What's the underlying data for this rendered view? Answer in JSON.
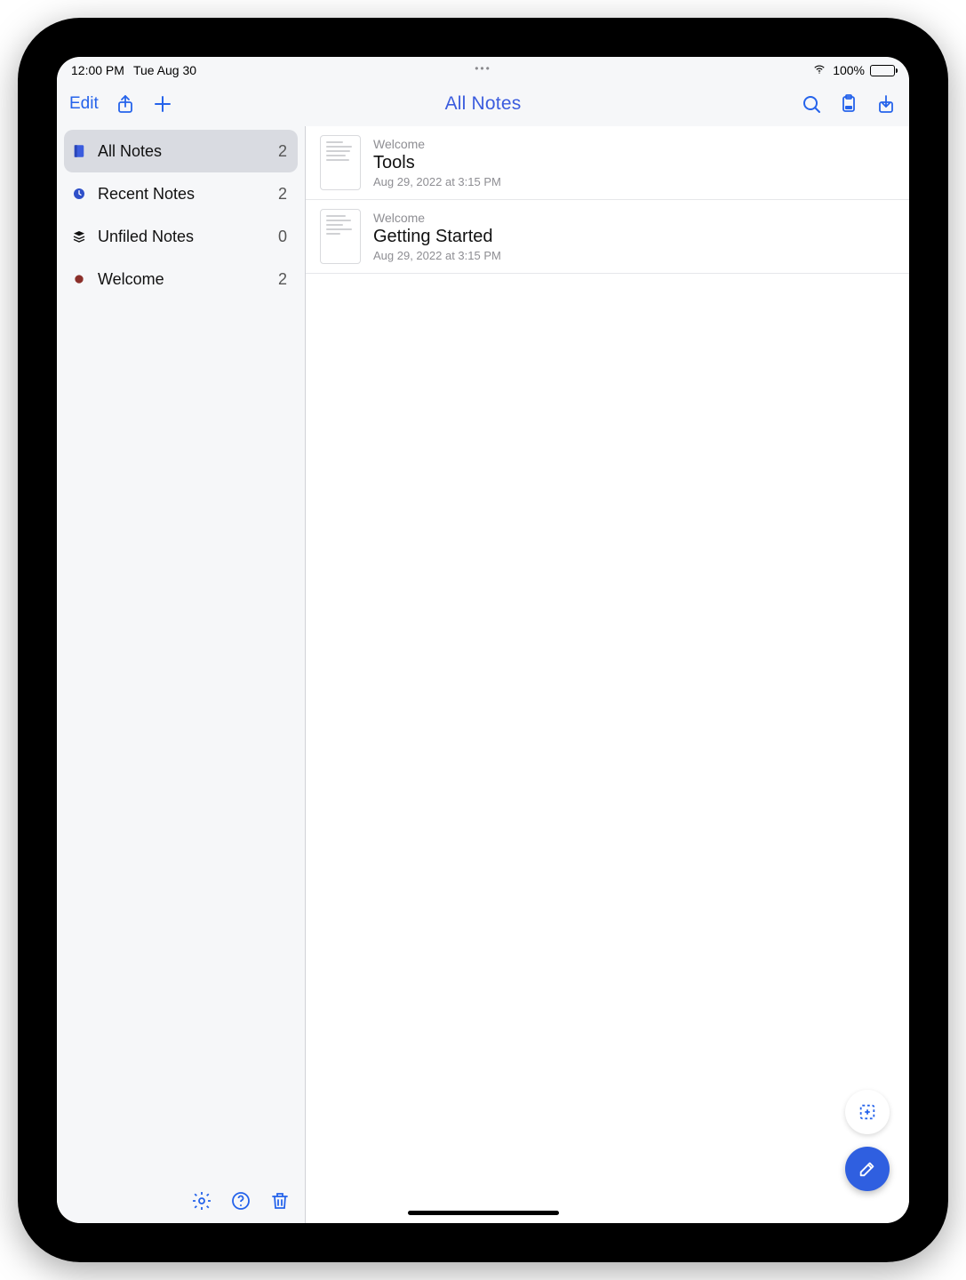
{
  "status": {
    "time": "12:00 PM",
    "date": "Tue Aug 30",
    "battery": "100%"
  },
  "navbar": {
    "edit": "Edit",
    "title": "All Notes"
  },
  "sidebar": {
    "items": [
      {
        "id": "all-notes",
        "label": "All Notes",
        "count": "2",
        "selected": true
      },
      {
        "id": "recent-notes",
        "label": "Recent Notes",
        "count": "2",
        "selected": false
      },
      {
        "id": "unfiled",
        "label": "Unfiled Notes",
        "count": "0",
        "selected": false
      },
      {
        "id": "welcome",
        "label": "Welcome",
        "count": "2",
        "selected": false
      }
    ]
  },
  "notes": [
    {
      "category": "Welcome",
      "title": "Tools",
      "date": "Aug 29, 2022 at 3:15 PM"
    },
    {
      "category": "Welcome",
      "title": "Getting Started",
      "date": "Aug 29, 2022 at 3:15 PM"
    }
  ]
}
